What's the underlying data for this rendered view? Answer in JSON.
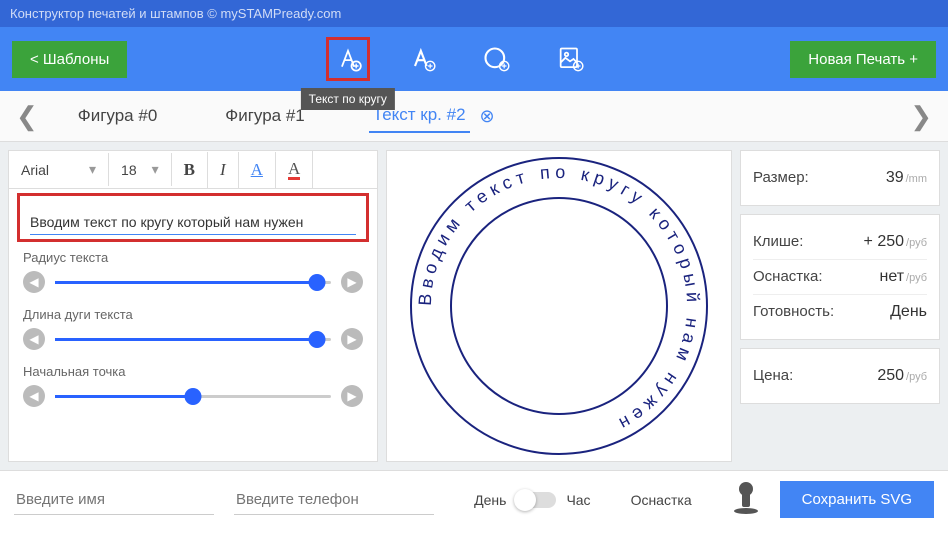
{
  "titlebar": "Конструктор печатей и штампов © mySTAMPready.com",
  "toolbar": {
    "templates_label": "<  Шаблоны",
    "new_label": "Новая Печать +",
    "tooltip": "Текст по кругу"
  },
  "tabs": {
    "items": [
      {
        "label": "Фигура #0",
        "active": false
      },
      {
        "label": "Фигура #1",
        "active": false
      },
      {
        "label": "Текст кр. #2",
        "active": true
      }
    ]
  },
  "font": {
    "family": "Arial",
    "size": "18"
  },
  "text_input": "Вводим текст по кругу который нам нужен",
  "sliders": [
    {
      "label": "Радиус текста",
      "pct": 95
    },
    {
      "label": "Длина дуги текста",
      "pct": 95
    },
    {
      "label": "Начальная точка",
      "pct": 50
    }
  ],
  "circle_text": "Вводим текст по кругу который нам нужен",
  "info": {
    "size_label": "Размер:",
    "size_val": "39",
    "size_unit": "/mm",
    "klise_label": "Клише:",
    "klise_val": "+ 250",
    "rub": "/руб",
    "osn_label": "Оснастка:",
    "osn_val": "нет",
    "ready_label": "Готовность:",
    "ready_val": "День",
    "price_label": "Цена:",
    "price_val": "250"
  },
  "bottom": {
    "name_ph": "Введите имя",
    "phone_ph": "Введите телефон",
    "day": "День",
    "hour": "Час",
    "osn": "Оснастка",
    "save": "Сохранить SVG"
  }
}
